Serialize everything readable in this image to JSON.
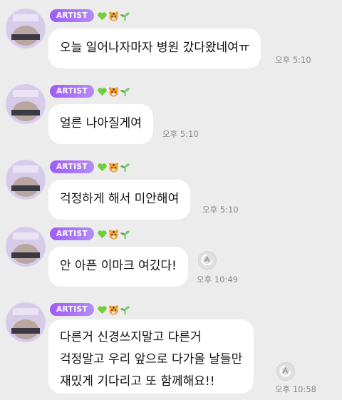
{
  "messages": [
    {
      "badge": "ARTIST",
      "text_lines": [
        "오늘 일어나자마자 병원 갔다왔네여ㅠ"
      ],
      "time": "오후 5:10",
      "translate": false
    },
    {
      "badge": "ARTIST",
      "text_lines": [
        "얼른 나아질게여"
      ],
      "time": "오후 5:10",
      "translate": false
    },
    {
      "badge": "ARTIST",
      "text_lines": [
        "걱정하게 해서 미안해여"
      ],
      "time": "오후 5:10",
      "translate": false
    },
    {
      "badge": "ARTIST",
      "text_lines": [
        "안 아픈 이마크 여깄다!"
      ],
      "time": "오후 10:49",
      "translate": true
    },
    {
      "badge": "ARTIST",
      "text_lines": [
        "다른거 신경쓰지말고 다른거",
        "걱정말고 우리 앞으로 다가올 날들만",
        "재밌게 기다리고 또 함께해요!!"
      ],
      "time": "오후 10:58",
      "translate": true
    }
  ],
  "name_emojis": [
    "green-heart",
    "tiger-face",
    "seedling"
  ],
  "colors": {
    "background": "#ececec",
    "bubble": "#ffffff",
    "badge_start": "#9e5cf5",
    "badge_end": "#b68cf7",
    "time": "#888888"
  }
}
